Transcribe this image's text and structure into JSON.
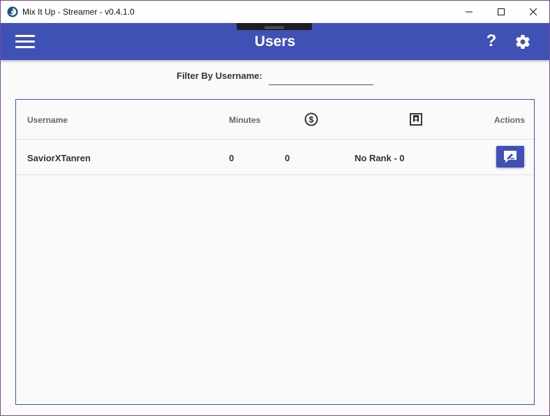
{
  "window": {
    "title": "Mix It Up - Streamer - v0.4.1.0",
    "controls": [
      "minimize",
      "maximize",
      "close"
    ]
  },
  "appbar": {
    "title": "Users",
    "help_label": "?",
    "accent_color": "#3f51b5"
  },
  "filter": {
    "label": "Filter By Username:",
    "value": "",
    "placeholder": ""
  },
  "table": {
    "columns": {
      "username": "Username",
      "minutes": "Minutes",
      "currency_icon": "dollar-circle-icon",
      "rank_icon": "rank-badge-icon",
      "actions": "Actions"
    },
    "rows": [
      {
        "username": "SaviorXTanren",
        "minutes": "0",
        "currency": "0",
        "rank": "No Rank - 0",
        "action_icon": "chat-edit-icon"
      }
    ]
  }
}
